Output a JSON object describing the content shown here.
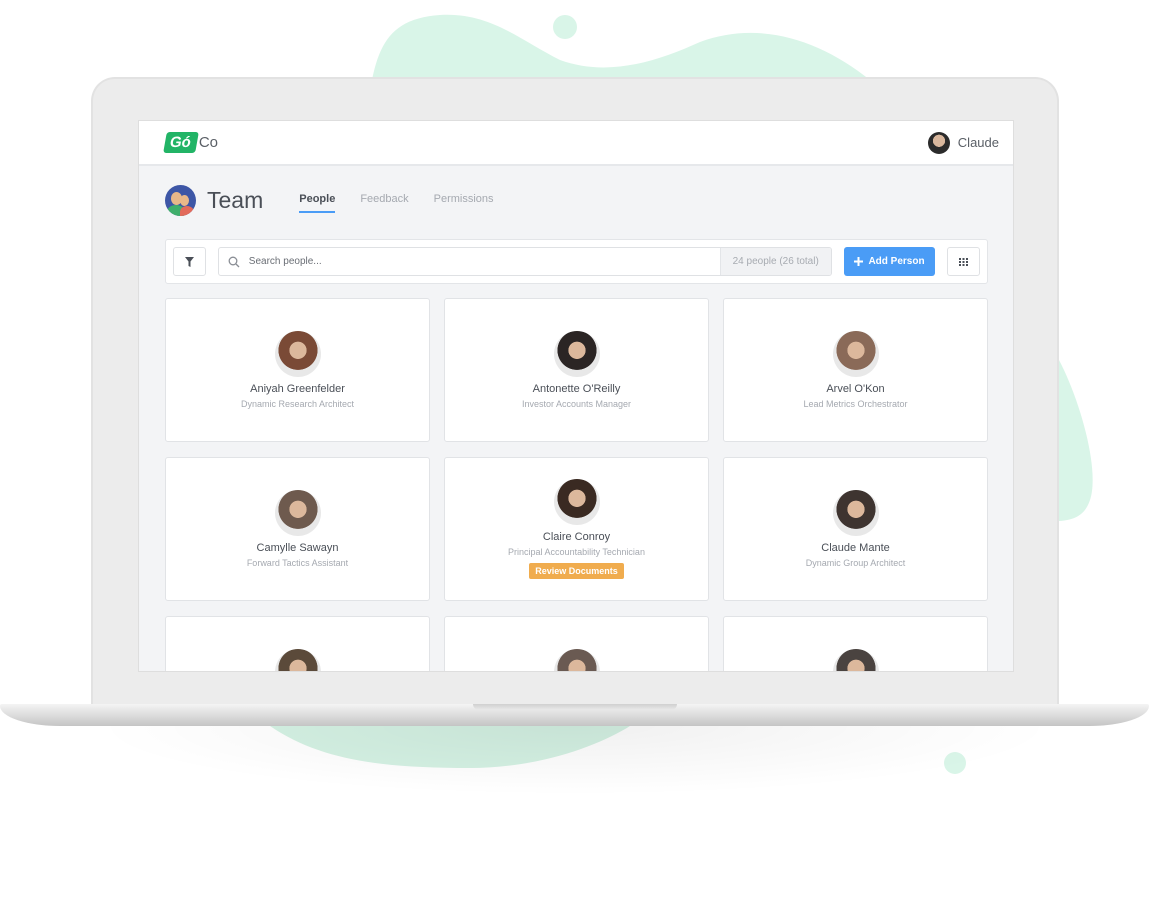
{
  "app": {
    "logo_primary": "Gó",
    "logo_secondary": "Co",
    "user_name": "Claude"
  },
  "header": {
    "title": "Team",
    "tabs": [
      {
        "label": "People",
        "active": true
      },
      {
        "label": "Feedback",
        "active": false
      },
      {
        "label": "Permissions",
        "active": false
      }
    ]
  },
  "toolbar": {
    "search_placeholder": "Search people...",
    "search_value": "",
    "count_text": "24 people (26 total)",
    "add_label": "Add Person",
    "icons": {
      "filter": "filter-icon",
      "search": "search-icon",
      "add": "plus-icon",
      "grid": "grid-icon"
    }
  },
  "colors": {
    "brand": "#22b466",
    "accent": "#4a9cf6",
    "badge": "#f0ac4e",
    "blob": "#d9f5e8"
  },
  "people": [
    {
      "name": "Aniyah Greenfelder",
      "role": "Dynamic Research Architect",
      "badge": null,
      "avatar_color": "#7a4a36"
    },
    {
      "name": "Antonette O'Reilly",
      "role": "Investor Accounts Manager",
      "badge": null,
      "avatar_color": "#2b2524"
    },
    {
      "name": "Arvel O'Kon",
      "role": "Lead Metrics Orchestrator",
      "badge": null,
      "avatar_color": "#8a6a58"
    },
    {
      "name": "Camylle Sawayn",
      "role": "Forward Tactics Assistant",
      "badge": null,
      "avatar_color": "#6e5a4e"
    },
    {
      "name": "Claire Conroy",
      "role": "Principal Accountability Technician",
      "badge": "Review Documents",
      "avatar_color": "#3a2a22"
    },
    {
      "name": "Claude Mante",
      "role": "Dynamic Group Architect",
      "badge": null,
      "avatar_color": "#3e3430"
    }
  ],
  "people_partial": [
    {
      "avatar_color": "#5b4a3a"
    },
    {
      "avatar_color": "#6a5a52"
    },
    {
      "avatar_color": "#4a4340"
    }
  ]
}
